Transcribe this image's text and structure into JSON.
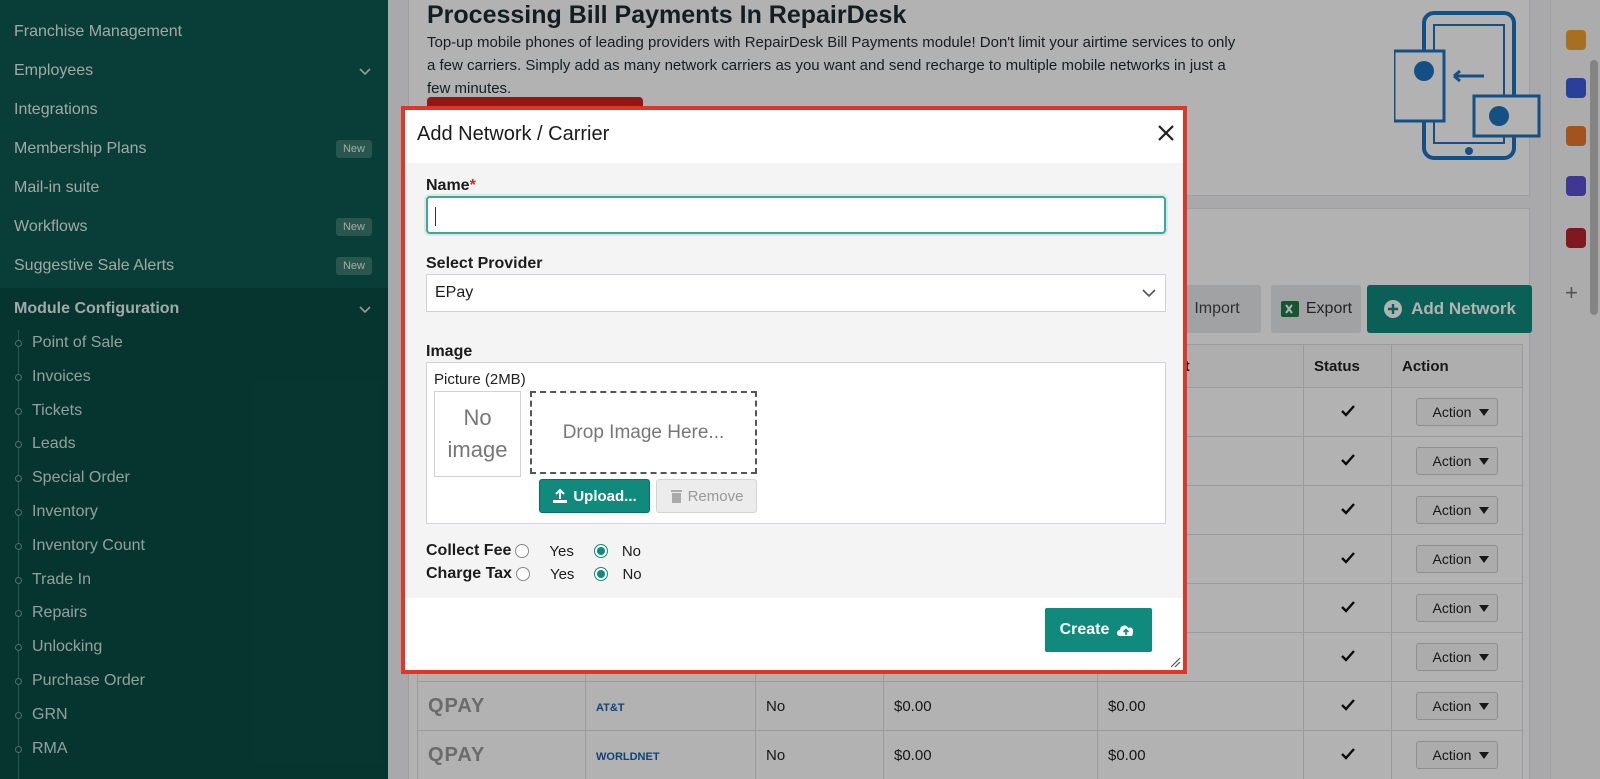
{
  "sidebar": {
    "items": [
      {
        "label": "Franchise Management"
      },
      {
        "label": "Employees"
      },
      {
        "label": "Integrations"
      },
      {
        "label": "Membership Plans",
        "badge": "New"
      },
      {
        "label": "Mail-in suite"
      },
      {
        "label": "Workflows",
        "badge": "New"
      },
      {
        "label": "Suggestive Sale Alerts",
        "badge": "New"
      }
    ],
    "group_title": "Module Configuration",
    "sub_items": [
      "Point of Sale",
      "Invoices",
      "Tickets",
      "Leads",
      "Special Order",
      "Inventory",
      "Inventory Count",
      "Trade In",
      "Repairs",
      "Unlocking",
      "Purchase Order",
      "GRN",
      "RMA"
    ]
  },
  "banner": {
    "title": "Processing Bill Payments In RepairDesk",
    "description": "Top-up mobile phones of leading providers with RepairDesk Bill Payments module! Don't limit your airtime services to only a few carriers. Simply add as many network carriers as you want and send recharge to multiple mobile networks in just a few minutes."
  },
  "toolbar": {
    "import_label": "Import",
    "export_label": "Export",
    "add_label": "Add Network"
  },
  "table": {
    "headers": [
      "",
      "",
      "",
      "",
      "ection Cost",
      "Status",
      "Action"
    ],
    "rows": [
      {
        "provider": "",
        "carrier": "",
        "c3": "",
        "c4": "",
        "c5": "",
        "action": "Action"
      },
      {
        "provider": "",
        "carrier": "",
        "c3": "",
        "c4": "",
        "c5": "",
        "action": "Action"
      },
      {
        "provider": "",
        "carrier": "",
        "c3": "",
        "c4": "",
        "c5": "",
        "action": "Action"
      },
      {
        "provider": "",
        "carrier": "",
        "c3": "",
        "c4": "",
        "c5": "",
        "action": "Action"
      },
      {
        "provider": "",
        "carrier": "",
        "c3": "",
        "c4": "",
        "c5": "",
        "action": "Action"
      },
      {
        "provider": "",
        "carrier": "",
        "c3": "",
        "c4": "",
        "c5": "",
        "action": "Action"
      },
      {
        "provider": "QPAY",
        "carrier": "AT&T",
        "c3": "No",
        "c4": "$0.00",
        "c5": "$0.00",
        "action": "Action"
      },
      {
        "provider": "QPAY",
        "carrier": "WORLDNET",
        "c3": "No",
        "c4": "$0.00",
        "c5": "$0.00",
        "action": "Action"
      }
    ]
  },
  "modal": {
    "title": "Add Network / Carrier",
    "name_label": "Name",
    "name_required": "*",
    "name_value": "",
    "provider_label": "Select Provider",
    "provider_value": "EPay",
    "image_label": "Image",
    "picture_label": "Picture (2MB)",
    "no_image_text": "No image",
    "drop_text": "Drop Image Here...",
    "upload_label": "Upload...",
    "remove_label": "Remove",
    "collect_fee_label": "Collect Fee",
    "charge_tax_label": "Charge Tax",
    "yes_label": "Yes",
    "no_label": "No",
    "collect_fee_selected": "No",
    "charge_tax_selected": "No",
    "create_label": "Create"
  },
  "colors": {
    "sidebar": "#0c5a50",
    "accent": "#0f8a7c",
    "modal_border": "#e0362a"
  }
}
